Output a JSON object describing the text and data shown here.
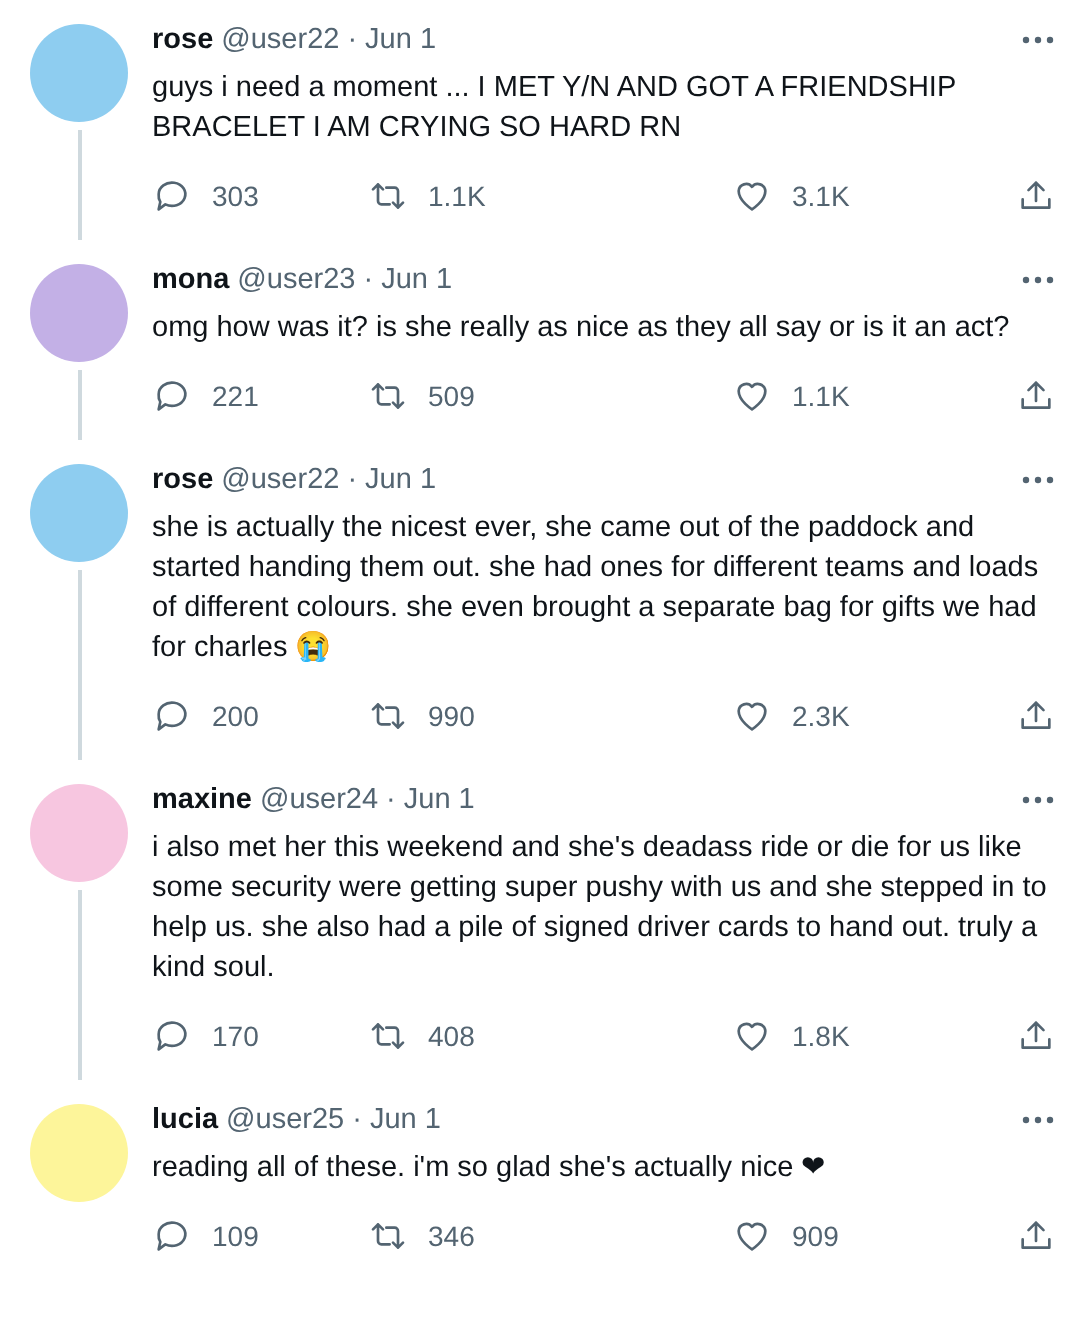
{
  "tweets": [
    {
      "name": "rose",
      "handle": "@user22",
      "date": "· Jun 1",
      "color": "#8ecdf0",
      "text": "guys i need a moment ... I MET Y/N AND GOT A FRIENDSHIP BRACELET I AM CRYING SO HARD RN",
      "replies": "303",
      "retweets": "1.1K",
      "likes": "3.1K"
    },
    {
      "name": "mona",
      "handle": "@user23",
      "date": "· Jun 1",
      "color": "#c3b0e6",
      "text": "omg how was it? is she really as nice as they all say or is it an act?",
      "replies": "221",
      "retweets": "509",
      "likes": "1.1K"
    },
    {
      "name": "rose",
      "handle": "@user22",
      "date": "· Jun 1",
      "color": "#8ecdf0",
      "text": "she is actually the nicest ever, she came out of the paddock and started handing them out. she had ones for different teams and loads of different colours. she even brought a separate bag for gifts we had for charles 😭",
      "replies": "200",
      "retweets": "990",
      "likes": "2.3K"
    },
    {
      "name": "maxine",
      "handle": "@user24",
      "date": "· Jun 1",
      "color": "#f7c6e0",
      "text": "i also met her this weekend and she's deadass ride or die for us like some security were getting super pushy with us and she stepped in to help us. she also had a pile of signed driver cards to hand out. truly a kind soul.",
      "replies": "170",
      "retweets": "408",
      "likes": "1.8K"
    },
    {
      "name": "lucia",
      "handle": "@user25",
      "date": "· Jun 1",
      "color": "#fdf59a",
      "text": "reading all of these. i'm so glad she's actually nice ❤",
      "replies": "109",
      "retweets": "346",
      "likes": "909"
    }
  ]
}
